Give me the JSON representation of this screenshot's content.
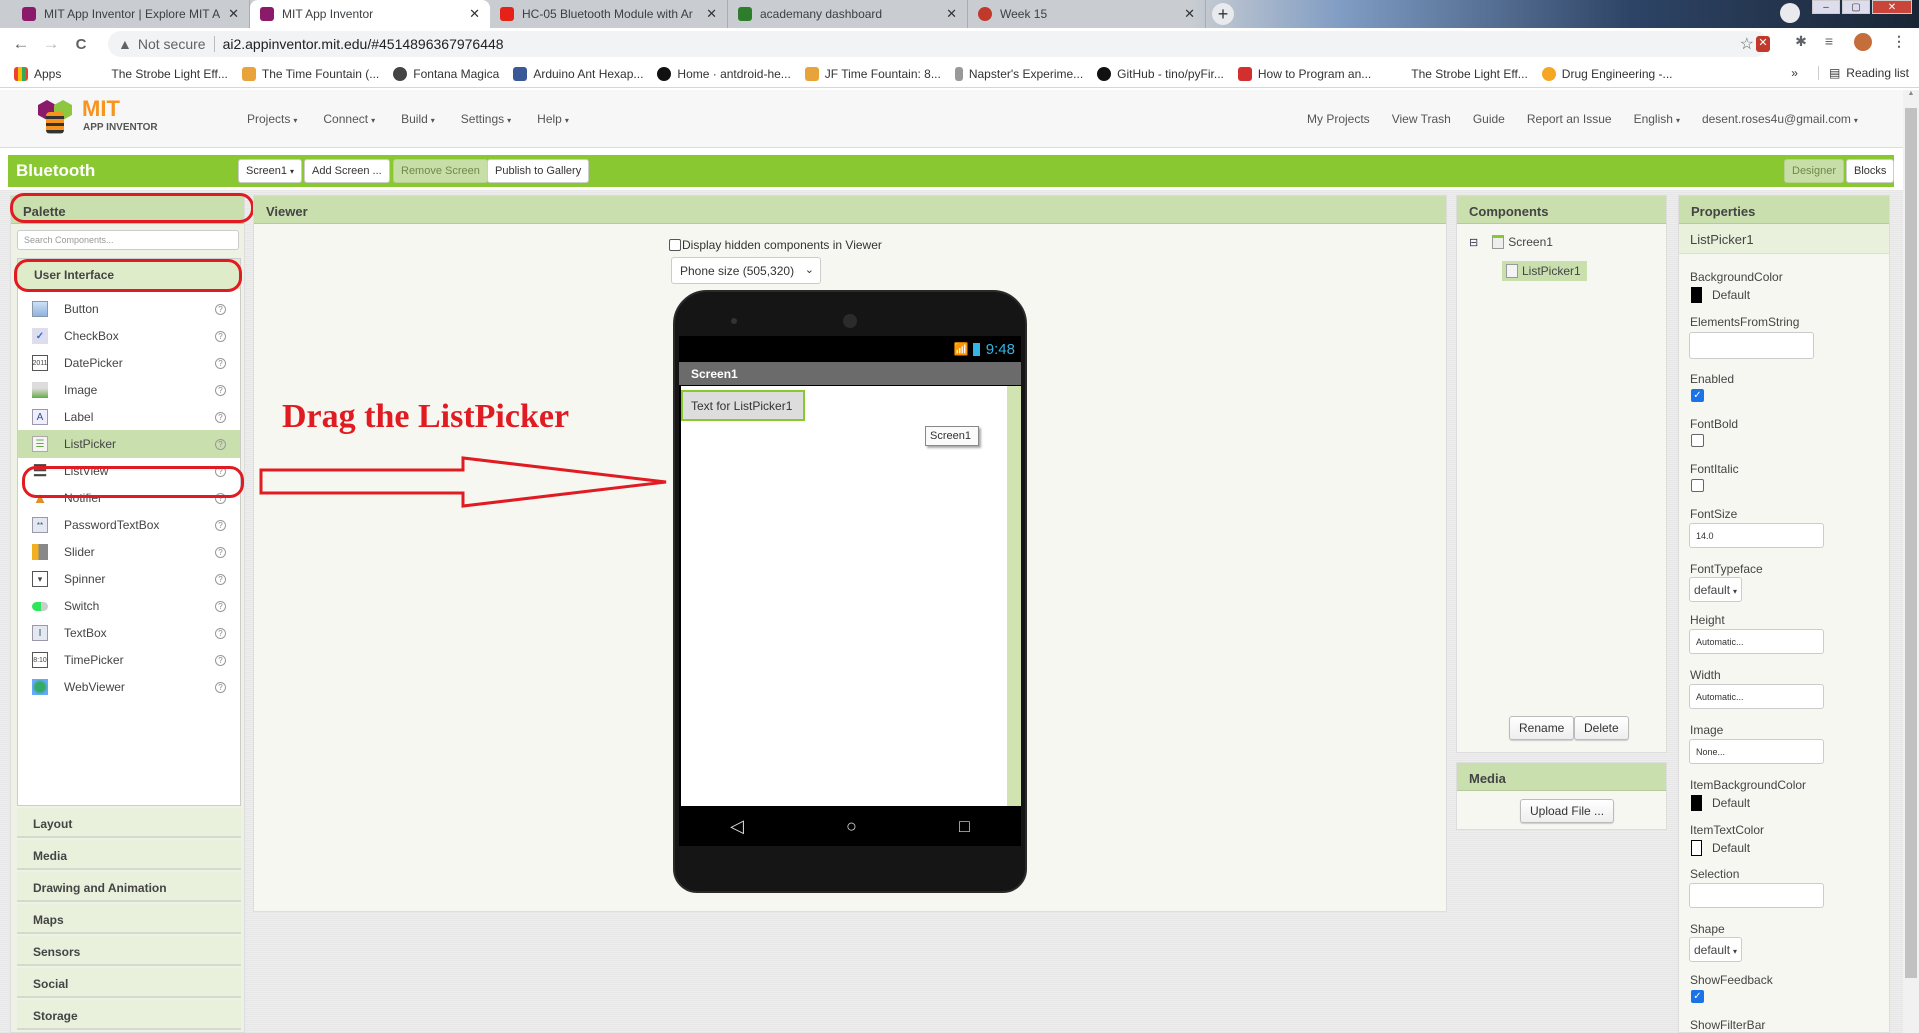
{
  "browser": {
    "tabs": [
      {
        "title": "MIT App Inventor | Explore MIT A",
        "color": "#8b1a6b",
        "active": false
      },
      {
        "title": "MIT App Inventor",
        "color": "#8b1a6b",
        "active": true
      },
      {
        "title": "HC-05 Bluetooth Module with Ar",
        "color": "#e62117",
        "active": false
      },
      {
        "title": "academany dashboard",
        "color": "#2d7d2d",
        "active": false
      },
      {
        "title": "Week 15",
        "color": "#c0392b",
        "active": false
      }
    ],
    "new_tab": "+",
    "window": {
      "minimize": "–",
      "maximize": "▢",
      "close": "✕"
    },
    "nav": {
      "back": "←",
      "forward": "→",
      "reload": "C"
    },
    "address": {
      "warning_icon": "▲",
      "security": "Not secure",
      "url": "ai2.appinventor.mit.edu/#4514896367976448"
    },
    "bookmarks": [
      {
        "label": "Apps",
        "color": "#4285f4"
      },
      {
        "label": "The Strobe Light Eff...",
        "color": ""
      },
      {
        "label": "The Time Fountain (...",
        "color": "#e8a33b"
      },
      {
        "label": "Fontana Magica",
        "color": "#444"
      },
      {
        "label": "Arduino Ant Hexap...",
        "color": "#3b5998"
      },
      {
        "label": "Home · antdroid-he...",
        "color": "#111"
      },
      {
        "label": "JF Time Fountain: 8...",
        "color": "#e8a33b"
      },
      {
        "label": "Napster's Experime...",
        "color": "#666"
      },
      {
        "label": "GitHub - tino/pyFir...",
        "color": "#111"
      },
      {
        "label": "How to Program an...",
        "color": "#d32f2f"
      },
      {
        "label": "The Strobe Light Eff...",
        "color": ""
      },
      {
        "label": "Drug Engineering -...",
        "color": "#f5a623"
      }
    ],
    "more_bookmarks": "»",
    "reading_list": "Reading list"
  },
  "app": {
    "logo": {
      "mit": "MIT",
      "sub": "APP INVENTOR"
    },
    "menu": [
      "Projects",
      "Connect",
      "Build",
      "Settings",
      "Help"
    ],
    "right_menu": [
      "My Projects",
      "View Trash",
      "Guide",
      "Report an Issue"
    ],
    "language": "English",
    "account": "desent.roses4u@gmail.com",
    "project_name": "Bluetooth",
    "toolbar": {
      "screen": "Screen1",
      "add_screen": "Add Screen ...",
      "remove_screen": "Remove Screen",
      "publish": "Publish to Gallery",
      "designer": "Designer",
      "blocks": "Blocks"
    }
  },
  "palette": {
    "title": "Palette",
    "search_placeholder": "Search Components...",
    "open_category": "User Interface",
    "items": [
      {
        "label": "Button",
        "icon": "button-icon"
      },
      {
        "label": "CheckBox",
        "icon": "checkbox-icon"
      },
      {
        "label": "DatePicker",
        "icon": "datepicker-icon"
      },
      {
        "label": "Image",
        "icon": "image-icon"
      },
      {
        "label": "Label",
        "icon": "label-icon"
      },
      {
        "label": "ListPicker",
        "icon": "listpicker-icon",
        "selected": true
      },
      {
        "label": "ListView",
        "icon": "listview-icon"
      },
      {
        "label": "Notifier",
        "icon": "notifier-icon"
      },
      {
        "label": "PasswordTextBox",
        "icon": "password-icon"
      },
      {
        "label": "Slider",
        "icon": "slider-icon"
      },
      {
        "label": "Spinner",
        "icon": "spinner-icon"
      },
      {
        "label": "Switch",
        "icon": "switch-icon"
      },
      {
        "label": "TextBox",
        "icon": "textbox-icon"
      },
      {
        "label": "TimePicker",
        "icon": "timepicker-icon"
      },
      {
        "label": "WebViewer",
        "icon": "webviewer-icon"
      }
    ],
    "help_glyph": "?",
    "categories": [
      "Layout",
      "Media",
      "Drawing and Animation",
      "Maps",
      "Sensors",
      "Social",
      "Storage"
    ]
  },
  "viewer": {
    "title": "Viewer",
    "hidden_components_label": "Display hidden components in Viewer",
    "hidden_components_checked": false,
    "phone_size": "Phone size (505,320)",
    "phone": {
      "time": "9:48",
      "screen_title": "Screen1",
      "listpicker_text": "Text for ListPicker1",
      "drag_tooltip": "Screen1",
      "nav_keys": [
        "◁",
        "○",
        "□"
      ]
    },
    "annotation": "Drag the ListPicker"
  },
  "components": {
    "title": "Components",
    "tree": [
      {
        "label": "Screen1",
        "collapse": "⊟"
      },
      {
        "label": "ListPicker1",
        "selected": true
      }
    ],
    "rename": "Rename",
    "delete": "Delete"
  },
  "media": {
    "title": "Media",
    "upload": "Upload File ..."
  },
  "properties": {
    "title": "Properties",
    "component": "ListPicker1",
    "background_color": {
      "label": "BackgroundColor",
      "value": "Default"
    },
    "elements_from_string": {
      "label": "ElementsFromString",
      "value": ""
    },
    "enabled": {
      "label": "Enabled",
      "checked": true
    },
    "font_bold": {
      "label": "FontBold",
      "checked": false
    },
    "font_italic": {
      "label": "FontItalic",
      "checked": false
    },
    "font_size": {
      "label": "FontSize",
      "value": "14.0"
    },
    "font_typeface": {
      "label": "FontTypeface",
      "value": "default"
    },
    "height": {
      "label": "Height",
      "value": "Automatic..."
    },
    "width": {
      "label": "Width",
      "value": "Automatic..."
    },
    "image": {
      "label": "Image",
      "value": "None..."
    },
    "item_background_color": {
      "label": "ItemBackgroundColor",
      "value": "Default"
    },
    "item_text_color": {
      "label": "ItemTextColor",
      "value": "Default"
    },
    "selection": {
      "label": "Selection",
      "value": ""
    },
    "shape": {
      "label": "Shape",
      "value": "default"
    },
    "show_feedback": {
      "label": "ShowFeedback",
      "checked": true
    },
    "show_filter_bar": {
      "label": "ShowFilterBar"
    }
  },
  "colors": {
    "accent_green": "#8ac832",
    "panel_header": "#c9dfae",
    "annotation_red": "#e11b22",
    "status_blue": "#33b5e5"
  }
}
